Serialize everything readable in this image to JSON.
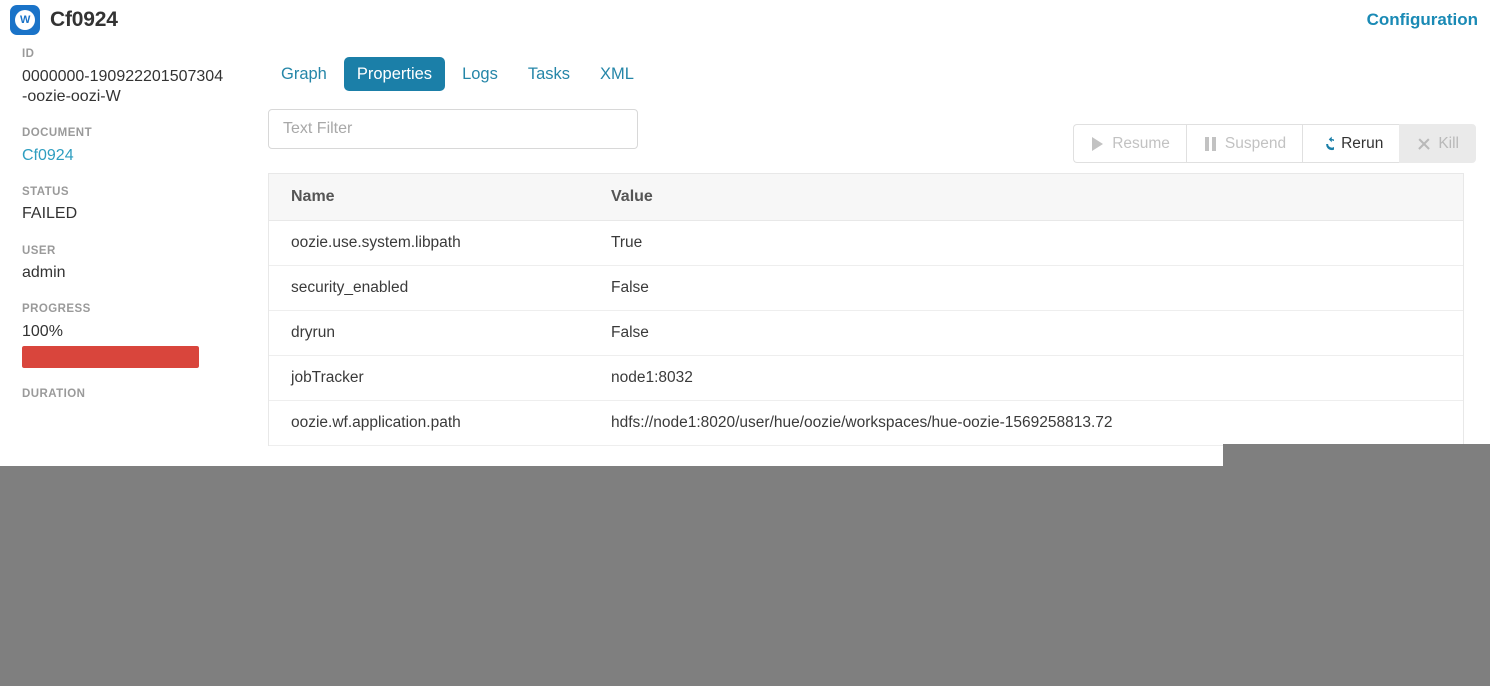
{
  "header": {
    "app_icon": "workflow-w-icon",
    "title": "Cf0924",
    "configuration_link": "Configuration"
  },
  "sidebar": {
    "id": {
      "label": "ID",
      "value": "0000000-190922201507304-oozie-oozi-W"
    },
    "document": {
      "label": "DOCUMENT",
      "value": "Cf0924"
    },
    "status": {
      "label": "STATUS",
      "value": "FAILED"
    },
    "user": {
      "label": "USER",
      "value": "admin"
    },
    "progress": {
      "label": "PROGRESS",
      "value": "100%",
      "percent": 100,
      "bar_color": "#d9453c"
    },
    "duration": {
      "label": "DURATION"
    }
  },
  "tabs": [
    {
      "label": "Graph",
      "active": false
    },
    {
      "label": "Properties",
      "active": true
    },
    {
      "label": "Logs",
      "active": false
    },
    {
      "label": "Tasks",
      "active": false
    },
    {
      "label": "XML",
      "active": false
    }
  ],
  "actions": [
    {
      "label": "Resume",
      "icon": "play-icon",
      "state": "disabled"
    },
    {
      "label": "Suspend",
      "icon": "pause-icon",
      "state": "disabled"
    },
    {
      "label": "Rerun",
      "icon": "refresh-icon",
      "state": "enabled"
    },
    {
      "label": "Kill",
      "icon": "close-x-icon",
      "state": "disabled"
    }
  ],
  "filter": {
    "placeholder": "Text Filter",
    "value": ""
  },
  "table": {
    "columns": [
      "Name",
      "Value"
    ],
    "rows": [
      {
        "name": "oozie.use.system.libpath",
        "value": "True",
        "is_link": true
      },
      {
        "name": "security_enabled",
        "value": "False",
        "is_link": false
      },
      {
        "name": "dryrun",
        "value": "False",
        "is_link": false
      },
      {
        "name": "jobTracker",
        "value": "node1:8032",
        "is_link": false
      },
      {
        "name": "oozie.wf.application.path",
        "value": "hdfs://node1:8020/user/hue/oozie/workspaces/hue-oozie-1569258813.72",
        "is_link": true
      }
    ]
  },
  "theme": {
    "accent": "#1b7fa8",
    "link": "#2e9ec0",
    "danger": "#d9453c",
    "overlay": "#7f7f7f"
  }
}
